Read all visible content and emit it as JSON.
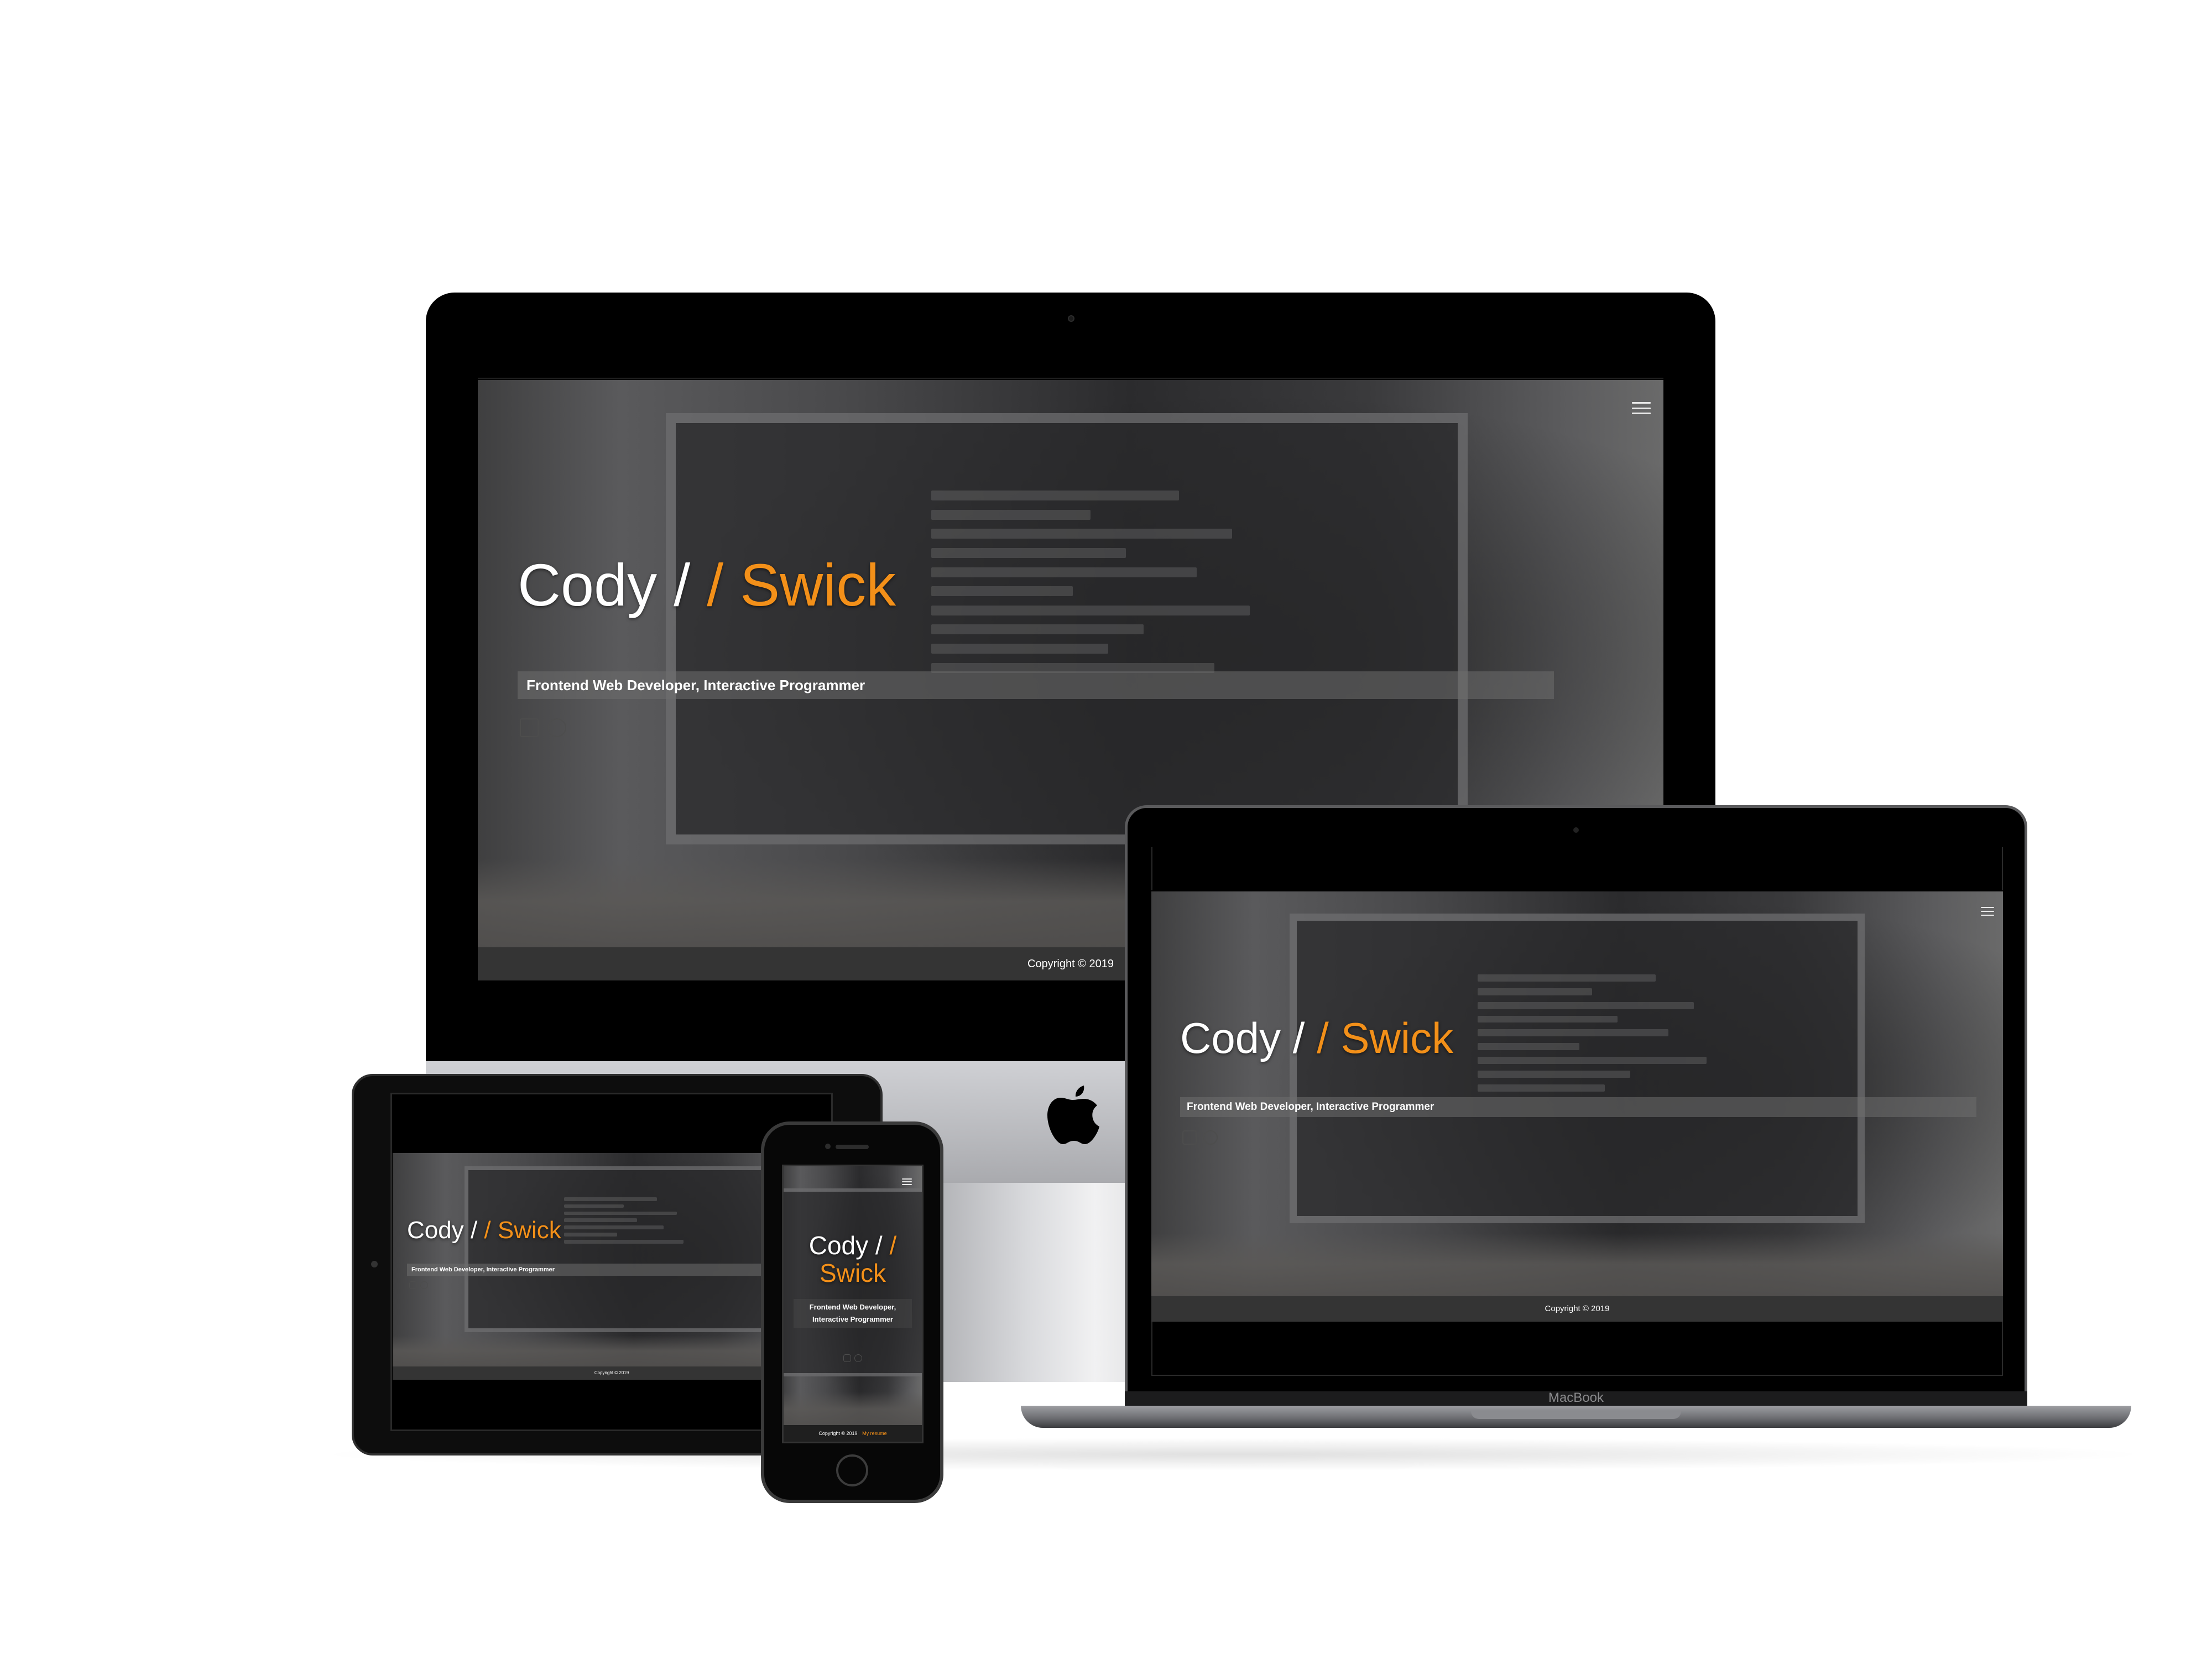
{
  "site": {
    "first_name": "Cody / ",
    "last_name": "/ Swick",
    "tagline": "Frontend Web Developer, Interactive Programmer",
    "footer_copyright": "Copyright © 2019",
    "footer_link": "My resume",
    "social_icons": [
      "linkedin-icon",
      "github-icon"
    ],
    "menu_icon": "hamburger-icon",
    "accent_color": "#f39019",
    "text_color": "#ffffff",
    "footer_bg": "#343434"
  },
  "devices": {
    "imac_logo": "apple-logo-icon",
    "macbook_label": "MacBook"
  }
}
